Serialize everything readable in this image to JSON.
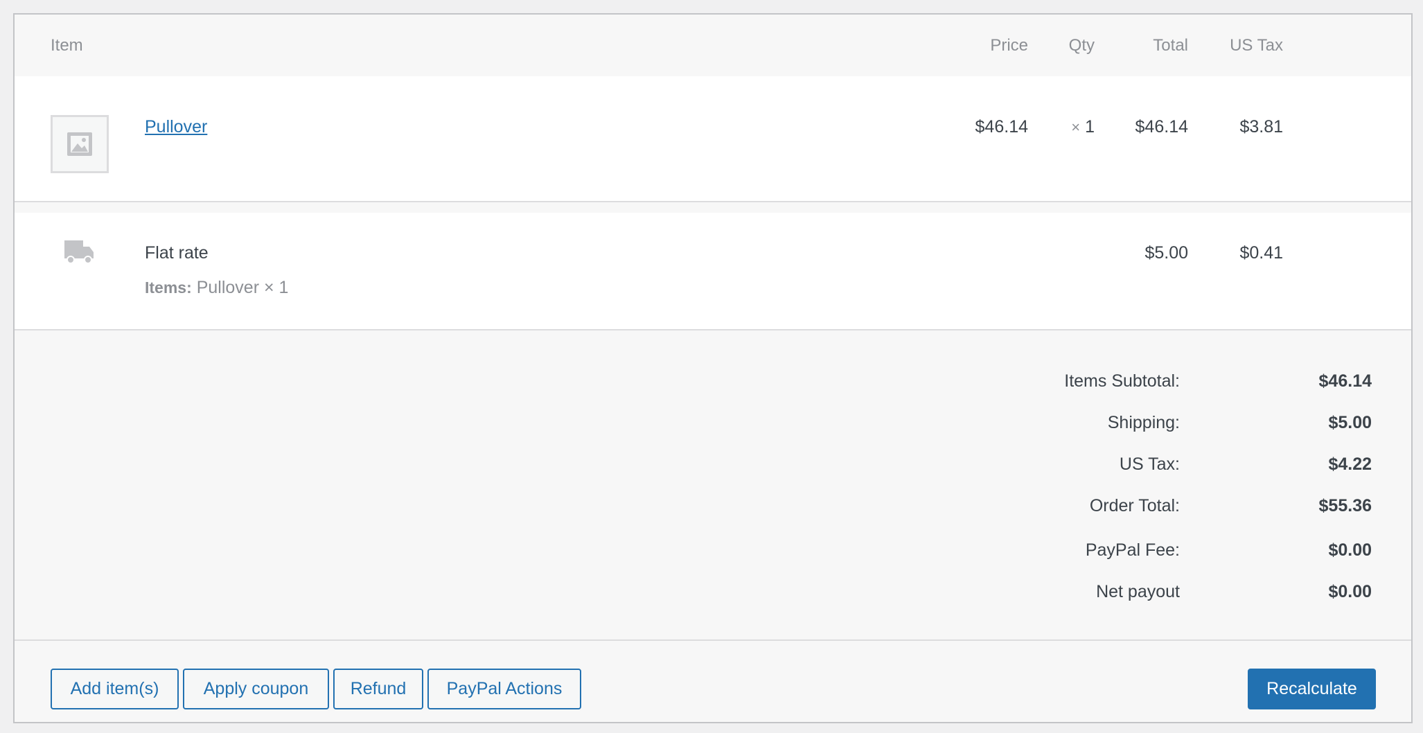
{
  "header": {
    "item": "Item",
    "price": "Price",
    "qty": "Qty",
    "total": "Total",
    "tax": "US Tax"
  },
  "line_item": {
    "name": "Pullover",
    "price": "$46.14",
    "qty_symbol": "×",
    "qty": "1",
    "total": "$46.14",
    "tax": "$3.81"
  },
  "shipping": {
    "method": "Flat rate",
    "items_label": "Items:",
    "items_value": "Pullover × 1",
    "total": "$5.00",
    "tax": "$0.41"
  },
  "totals": [
    {
      "label": "Items Subtotal:",
      "value": "$46.14"
    },
    {
      "label": "Shipping:",
      "value": "$5.00"
    },
    {
      "label": "US Tax:",
      "value": "$4.22"
    },
    {
      "label": "Order Total:",
      "value": "$55.36"
    },
    {
      "label": "PayPal Fee:",
      "value": "$0.00"
    },
    {
      "label": "Net payout",
      "value": "$0.00"
    }
  ],
  "actions": {
    "add_items": "Add item(s)",
    "apply_coupon": "Apply coupon",
    "refund": "Refund",
    "paypal_actions": "PayPal Actions",
    "recalculate": "Recalculate"
  },
  "colors": {
    "accent": "#2271b1",
    "muted": "#8c8f94",
    "text": "#3c434a"
  },
  "icons": {
    "product_placeholder": "image-placeholder-icon",
    "shipping": "truck-icon"
  }
}
